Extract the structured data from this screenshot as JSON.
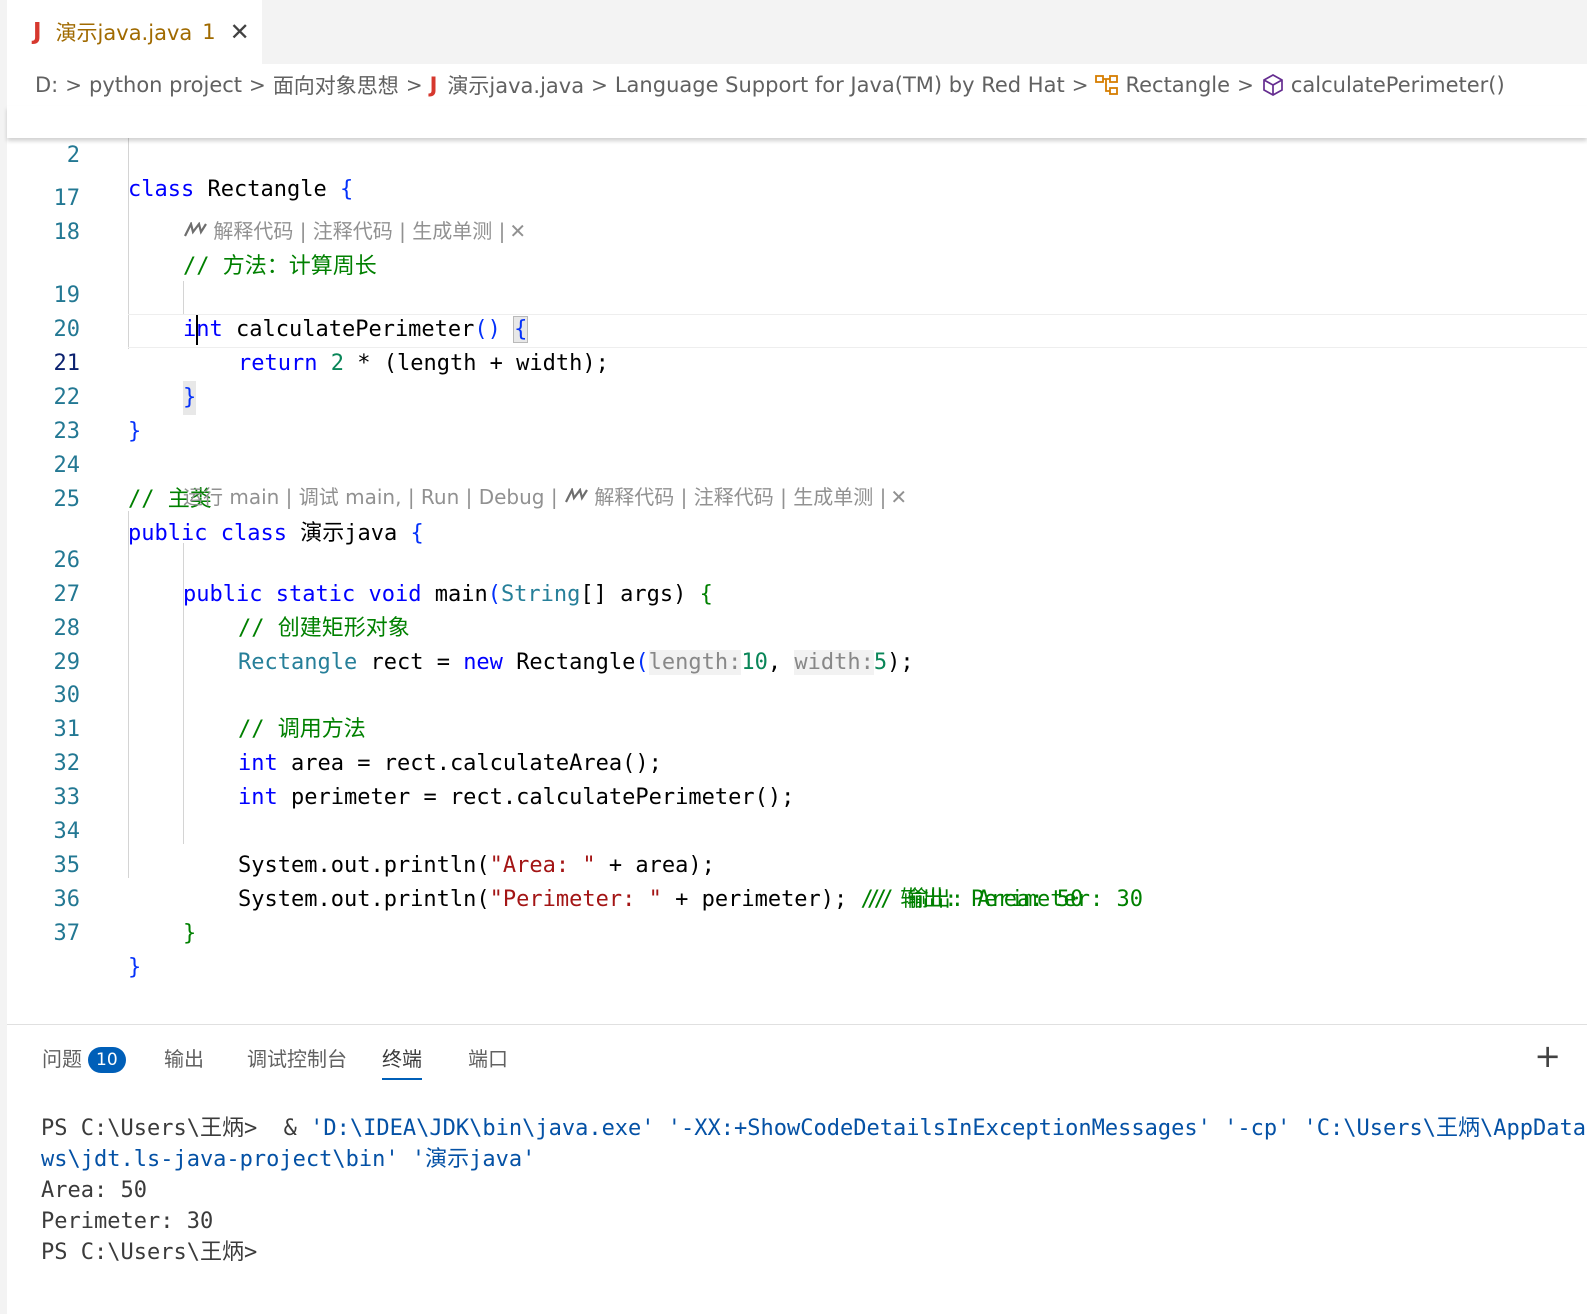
{
  "tab": {
    "icon_letter": "J",
    "title": "演示java.java",
    "problems": "1",
    "close_glyph": "✕"
  },
  "breadcrumb": {
    "items": [
      "D:",
      "python project",
      "面向对象思想",
      "演示java.java",
      "Language Support for Java(TM) by Red Hat",
      "Rectangle",
      "calculatePerimeter()"
    ],
    "file_icon_letter": "J",
    "separator": ">"
  },
  "sticky": {
    "line": "2",
    "code": [
      "class",
      "Rectangle",
      "{"
    ]
  },
  "editor": {
    "lines": {
      "l17": "17",
      "l18": "18",
      "l19": "19",
      "l20": "20",
      "l21": "21",
      "l22": "22",
      "l23": "23",
      "l24": "24",
      "l25": "25",
      "l26": "26",
      "l27": "27",
      "l28": "28",
      "l29": "29",
      "l30": "30",
      "l31": "31",
      "l32": "32",
      "l33": "33",
      "l34": "34",
      "l35": "35",
      "l36": "36",
      "l37": "37"
    },
    "code": {
      "c18": "// 方法：计算周长",
      "c19": [
        "int",
        "calculatePerimeter",
        "()",
        "{"
      ],
      "c20": [
        "return",
        "2",
        "* (length + width);"
      ],
      "c21": "}",
      "c22": "}",
      "c24": "// 主类",
      "c25": [
        "public",
        "class",
        "演示java",
        "{"
      ],
      "c26": [
        "public",
        "static",
        "void",
        "main",
        "(",
        "String",
        "[] args)",
        "{"
      ],
      "c27": "// 创建矩形对象",
      "c28": [
        "Rectangle",
        "rect = ",
        "new",
        "Rectangle",
        "(",
        "length:",
        "10",
        ", ",
        "width:",
        "5",
        ");"
      ],
      "c30": "// 调用方法",
      "c31": [
        "int",
        "area = rect.calculateArea",
        "();"
      ],
      "c32": [
        "int",
        "perimeter = rect.calculatePerimeter",
        "();"
      ],
      "c34": [
        "System.out.println(",
        "\"Area: \"",
        " + area);",
        "// 输出: Area: 50"
      ],
      "c35": [
        "System.out.println(",
        "\"Perimeter: \"",
        " + perimeter);",
        "// 输出: Perimeter: 30"
      ],
      "c36": "}",
      "c37": "}"
    },
    "lens1": "解释代码 | 注释代码 | 生成单测 |",
    "lens2": "运行 main | 调试 main, | Run | Debug | ",
    "lens2_ai": "解释代码 | 注释代码 | 生成单测 |",
    "lens_close": "✕"
  },
  "panel": {
    "tabs": [
      "问题",
      "输出",
      "调试控制台",
      "终端",
      "端口"
    ],
    "problems_count": "10",
    "active_tab": "终端",
    "add_glyph": "+"
  },
  "terminal": {
    "l1_prompt": "PS C:\\Users\\王炳>  & ",
    "l1_args": "'D:\\IDEA\\JDK\\bin\\java.exe' '-XX:+ShowCodeDetailsInExceptionMessages' '-cp' 'C:\\Users\\王炳\\AppData\\",
    "l2": "ws\\jdt.ls-java-project\\bin' '演示java'",
    "l3": "Area: 50",
    "l4": "Perimeter: 30",
    "l5": "PS C:\\Users\\王炳>"
  },
  "colors": {
    "keyword": "#0000ff",
    "type": "#267f99",
    "comment": "#008000",
    "string": "#a31515",
    "number": "#098658",
    "line_number": "#237893",
    "accent": "#005fb8",
    "java_icon": "#d6382e"
  }
}
